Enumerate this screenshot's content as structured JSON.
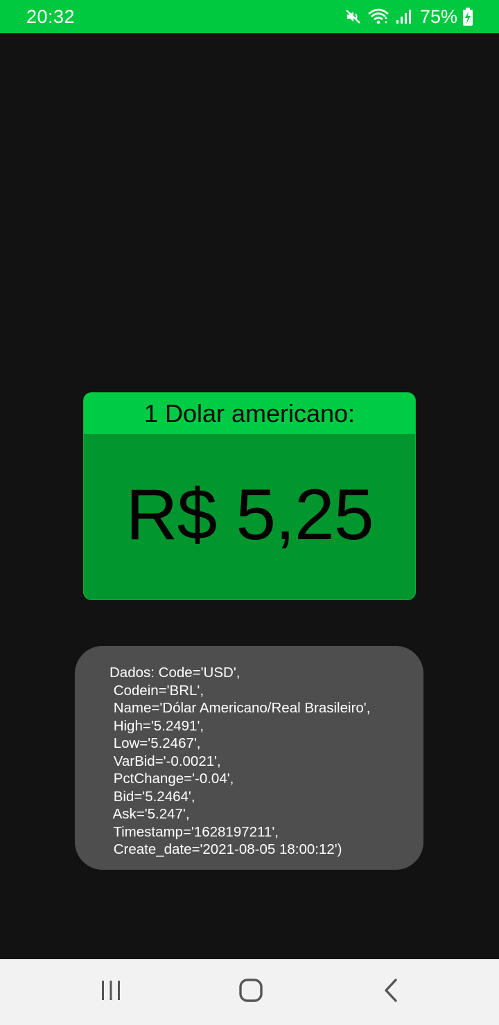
{
  "status_bar": {
    "time": "20:32",
    "battery": "75%",
    "icons": [
      "mute-icon",
      "wifi-icon",
      "signal-icon",
      "battery-charging-icon"
    ]
  },
  "rate_card": {
    "header": "1 Dolar americano:",
    "value": "R$ 5,25"
  },
  "data_box": {
    "lines": [
      "Dados: Code='USD',",
      " Codein='BRL',",
      " Name='Dólar Americano/Real Brasileiro',",
      " High='5.2491',",
      " Low='5.2467',",
      " VarBid='-0.0021',",
      " PctChange='-0.04',",
      " Bid='5.2464',",
      " Ask='5.247',",
      " Timestamp='1628197211',",
      " Create_date='2021-08-05 18:00:12')"
    ]
  },
  "nav_bar": {
    "icons": [
      "recent-apps-icon",
      "home-icon",
      "back-icon"
    ]
  },
  "colors": {
    "status_bar": "#00c940",
    "card_header": "#00cb44",
    "card_body": "#02962f",
    "data_box": "#4e4e4e",
    "background": "#121212",
    "nav_bar": "#f2f2f2"
  }
}
